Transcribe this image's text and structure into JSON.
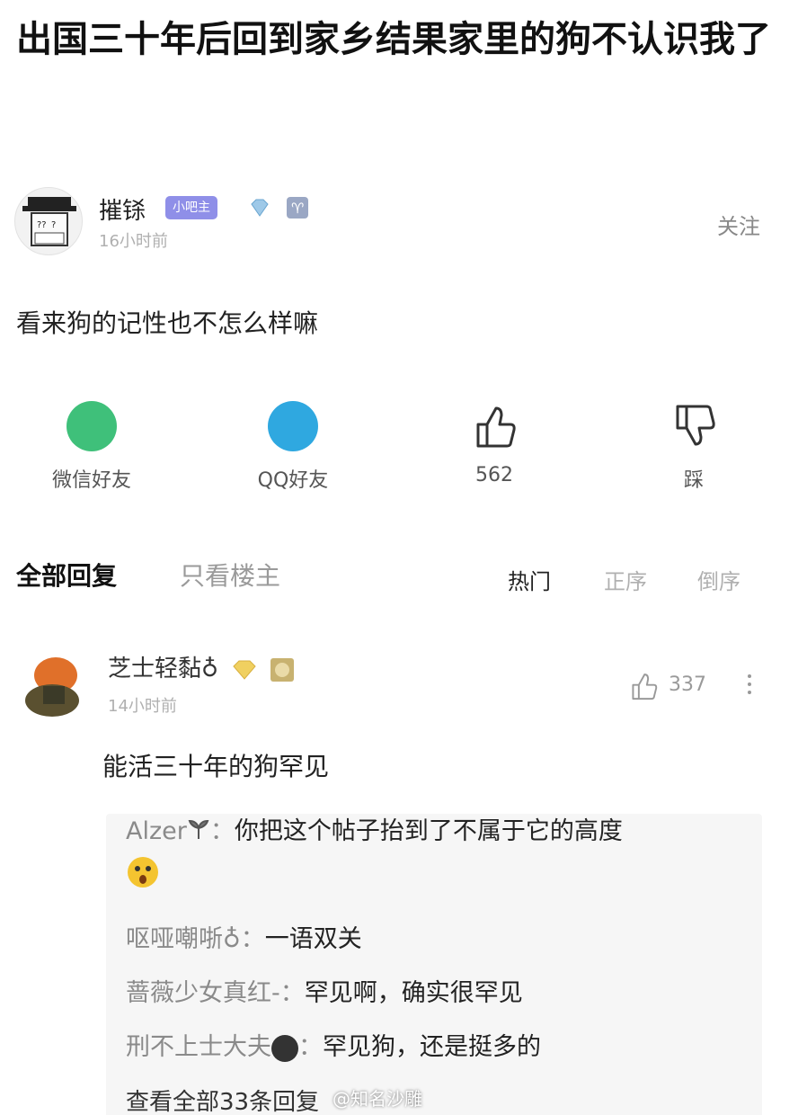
{
  "post": {
    "title": "出国三十年后回到家乡结果家里的狗不认识我了",
    "author": {
      "name": "摧铩",
      "badge": "小吧主",
      "time": "16小时前"
    },
    "follow_label": "关注",
    "body": "看来狗的记性也不怎么样嘛"
  },
  "actions": {
    "wechat_label": "微信好友",
    "qq_label": "QQ好友",
    "like_count": "562",
    "dislike_label": "踩"
  },
  "tabs": {
    "all": "全部回复",
    "owner_only": "只看楼主",
    "sort_hot": "热门",
    "sort_asc": "正序",
    "sort_desc": "倒序"
  },
  "comment": {
    "author": "芝士轻黏♁",
    "time": "14小时前",
    "like_count": "337",
    "text": "能活三十年的狗罕见",
    "replies": [
      {
        "who": "Alzer",
        "sep": "：",
        "text": "你把这个帖子抬到了不属于它的高度"
      },
      {
        "who": "呕哑嘲哳♁",
        "sep": "：",
        "text": "一语双关"
      },
      {
        "who": "蔷薇少女真红-",
        "sep": "：",
        "text": "罕见啊，确实很罕见"
      },
      {
        "who": "刑不上士大夫",
        "sep": "：",
        "text": "罕见狗，还是挺多的"
      }
    ],
    "view_all": "查看全部33条回复"
  },
  "watermark": "@知名沙雕",
  "colors": {
    "wechat": "#3fc07a",
    "qq": "#2fa8e0",
    "mod_badge": "#8f8fe8"
  }
}
